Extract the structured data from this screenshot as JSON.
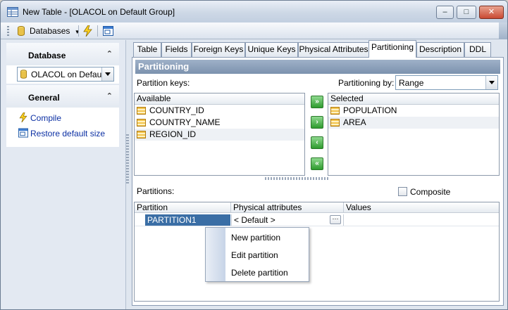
{
  "window": {
    "title": "New Table - [OLACOL on Default Group]",
    "controls": {
      "minimize": "–",
      "maximize": "□",
      "close": "✕"
    }
  },
  "toolbar": {
    "databases_label": "Databases"
  },
  "left_panel": {
    "database_header": "Database",
    "database_value": "OLACOL on Default",
    "general_header": "General",
    "collapse_glyph": "⌃",
    "links": {
      "compile": "Compile",
      "restore": "Restore default size"
    }
  },
  "tabs": [
    "Table",
    "Fields",
    "Foreign Keys",
    "Unique Keys",
    "Physical Attributes",
    "Partitioning",
    "Description",
    "DDL"
  ],
  "active_tab": "Partitioning",
  "partitioning": {
    "section_title": "Partitioning",
    "keys_label": "Partition keys:",
    "by_label": "Partitioning by:",
    "by_value": "Range",
    "available_header": "Available",
    "available": [
      "COUNTRY_ID",
      "COUNTRY_NAME",
      "REGION_ID"
    ],
    "selected_header": "Selected",
    "selected": [
      "POPULATION",
      "AREA"
    ],
    "arrows": {
      "add_all": "»",
      "add": "›",
      "remove": "‹",
      "remove_all": "«"
    },
    "partitions_label": "Partitions:",
    "composite_label": "Composite",
    "grid": {
      "headers": [
        "Partition",
        "Physical attributes",
        "Values"
      ],
      "rows": [
        {
          "partition": "PARTITION1",
          "physical": "< Default >",
          "values": ""
        }
      ],
      "ellipsis": "···"
    }
  },
  "context_menu": [
    "New partition",
    "Edit partition",
    "Delete partition"
  ],
  "colors": {
    "accent": "#3a6ea5",
    "header_blue": "#7c92ae",
    "link": "#0b2fa3"
  }
}
